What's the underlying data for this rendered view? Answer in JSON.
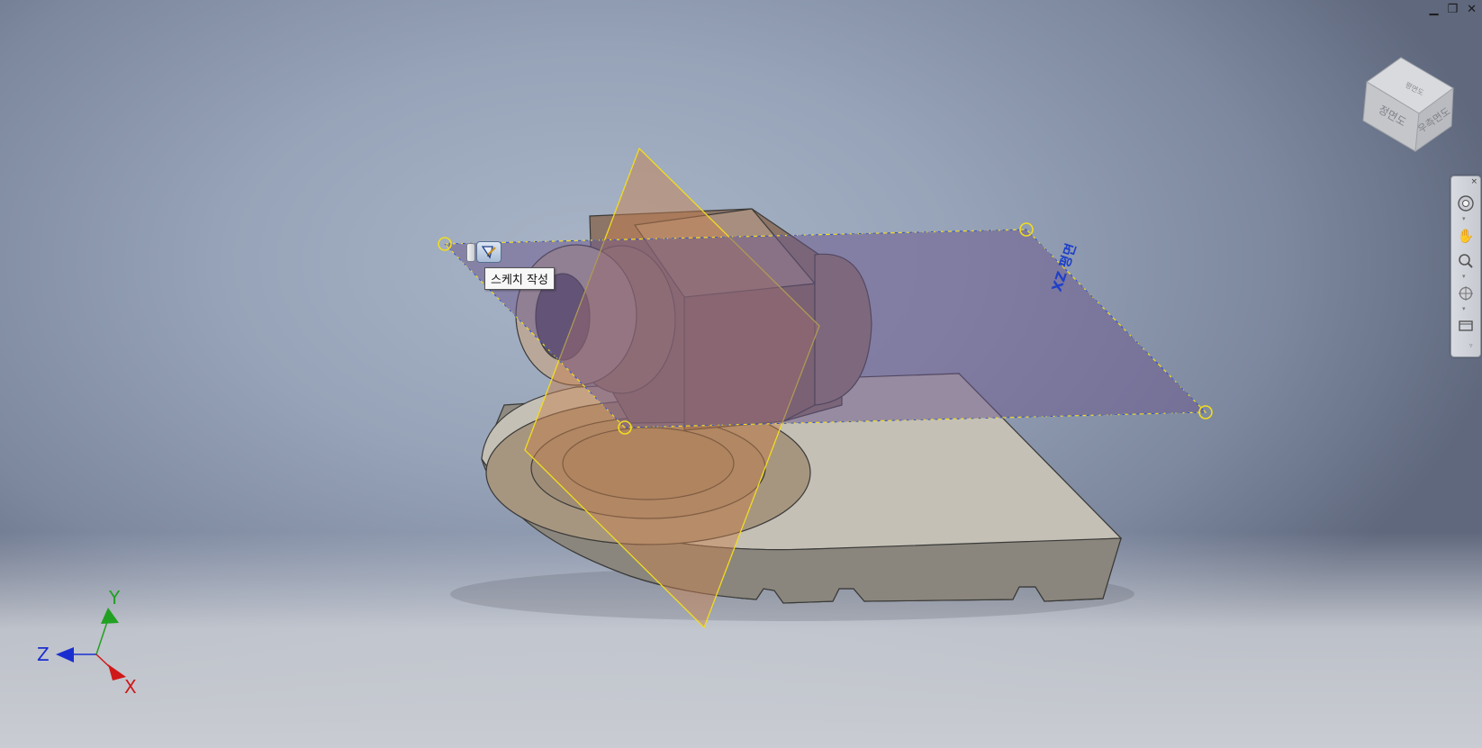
{
  "window_controls": {
    "minimize": "▁",
    "restore": "❐",
    "close": "✕"
  },
  "tooltip": {
    "text": "스케치 작성"
  },
  "plane_label": "XZ 평면",
  "viewcube": {
    "front": "정면도",
    "right": "우측면도",
    "top": "평면도"
  },
  "triad": {
    "x": "X",
    "y": "Y",
    "z": "Z",
    "x_color": "#d01818",
    "y_color": "#22a022",
    "z_color": "#1a2ed0"
  },
  "colors": {
    "accent": "#e8d000",
    "plane_blue": "#6b5a8c",
    "plane_orange": "#c08050",
    "part": "#b9b5ac"
  },
  "navbar": {
    "icons": [
      "steering-wheel-icon",
      "pan-icon",
      "zoom-icon",
      "orbit-icon",
      "look-at-icon"
    ]
  },
  "sketch_button": {
    "icon": "create-sketch-icon"
  }
}
